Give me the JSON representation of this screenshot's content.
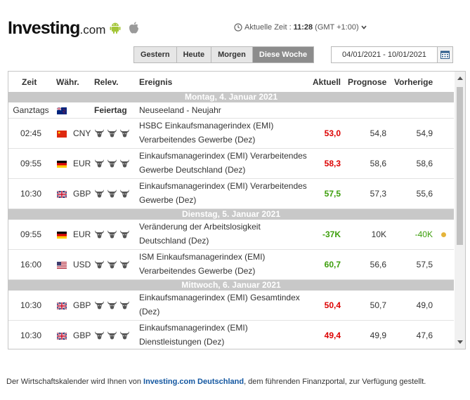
{
  "header": {
    "logo_main": "Investing",
    "logo_suffix": ".com",
    "clock_label": "Aktuelle Zeit :",
    "clock_time": "11:28",
    "clock_tz": "(GMT +1:00)"
  },
  "tabs": [
    {
      "label": "Gestern",
      "active": false
    },
    {
      "label": "Heute",
      "active": false
    },
    {
      "label": "Morgen",
      "active": false
    },
    {
      "label": "Diese Woche",
      "active": true
    }
  ],
  "date_range": "04/01/2021 - 10/01/2021",
  "columns": {
    "time": "Zeit",
    "currency": "Währ.",
    "relevance": "Relev.",
    "event": "Ereignis",
    "actual": "Aktuell",
    "forecast": "Prognose",
    "previous": "Vorherige"
  },
  "days": [
    {
      "label": "Montag, 4. Januar 2021",
      "rows": [
        {
          "time": "Ganztags",
          "flag": "NZ",
          "currency": "",
          "relevance": "Feiertag",
          "event_line1": "Neuseeland - Neujahr",
          "event_line2": "",
          "actual": "",
          "actual_color": "",
          "forecast": "",
          "previous": "",
          "dot": false
        },
        {
          "time": "02:45",
          "flag": "CN",
          "currency": "CNY",
          "relevance": "3",
          "event_line1": "HSBC Einkaufsmanagerindex (EMI)",
          "event_line2": "Verarbeitendes Gewerbe (Dez)",
          "actual": "53,0",
          "actual_color": "red",
          "forecast": "54,8",
          "previous": "54,9",
          "dot": false
        },
        {
          "time": "09:55",
          "flag": "DE",
          "currency": "EUR",
          "relevance": "3",
          "event_line1": "Einkaufsmanagerindex (EMI) Verarbeitendes",
          "event_line2": "Gewerbe Deutschland (Dez)",
          "actual": "58,3",
          "actual_color": "red",
          "forecast": "58,6",
          "previous": "58,6",
          "dot": false
        },
        {
          "time": "10:30",
          "flag": "GB",
          "currency": "GBP",
          "relevance": "3",
          "event_line1": "Einkaufsmanagerindex (EMI) Verarbeitendes",
          "event_line2": "Gewerbe (Dez)",
          "actual": "57,5",
          "actual_color": "green",
          "forecast": "57,3",
          "previous": "55,6",
          "dot": false
        }
      ]
    },
    {
      "label": "Dienstag, 5. Januar 2021",
      "rows": [
        {
          "time": "09:55",
          "flag": "DE",
          "currency": "EUR",
          "relevance": "3",
          "event_line1": "Veränderung der Arbeitslosigkeit",
          "event_line2": "Deutschland (Dez)",
          "actual": "-37K",
          "actual_color": "green",
          "forecast": "10K",
          "previous": "-40K",
          "previous_color": "green",
          "dot": true
        },
        {
          "time": "16:00",
          "flag": "US",
          "currency": "USD",
          "relevance": "3",
          "event_line1": "ISM Einkaufsmanagerindex (EMI)",
          "event_line2": "Verarbeitendes Gewerbe (Dez)",
          "actual": "60,7",
          "actual_color": "green",
          "forecast": "56,6",
          "previous": "57,5",
          "dot": false
        }
      ]
    },
    {
      "label": "Mittwoch, 6. Januar 2021",
      "rows": [
        {
          "time": "10:30",
          "flag": "GB",
          "currency": "GBP",
          "relevance": "3",
          "event_line1": "Einkaufsmanagerindex (EMI) Gesamtindex",
          "event_line2": "(Dez)",
          "actual": "50,4",
          "actual_color": "red",
          "forecast": "50,7",
          "previous": "49,0",
          "dot": false
        },
        {
          "time": "10:30",
          "flag": "GB",
          "currency": "GBP",
          "relevance": "3",
          "event_line1": "Einkaufsmanagerindex (EMI)",
          "event_line2": "Dienstleistungen (Dez)",
          "actual": "49,4",
          "actual_color": "red",
          "forecast": "49,9",
          "previous": "47,6",
          "dot": false
        }
      ]
    }
  ],
  "footer": {
    "prefix": "Der Wirtschaftskalender wird Ihnen von ",
    "link": "Investing.com Deutschland",
    "suffix": ", dem führenden Finanzportal, zur Verfügung gestellt."
  }
}
